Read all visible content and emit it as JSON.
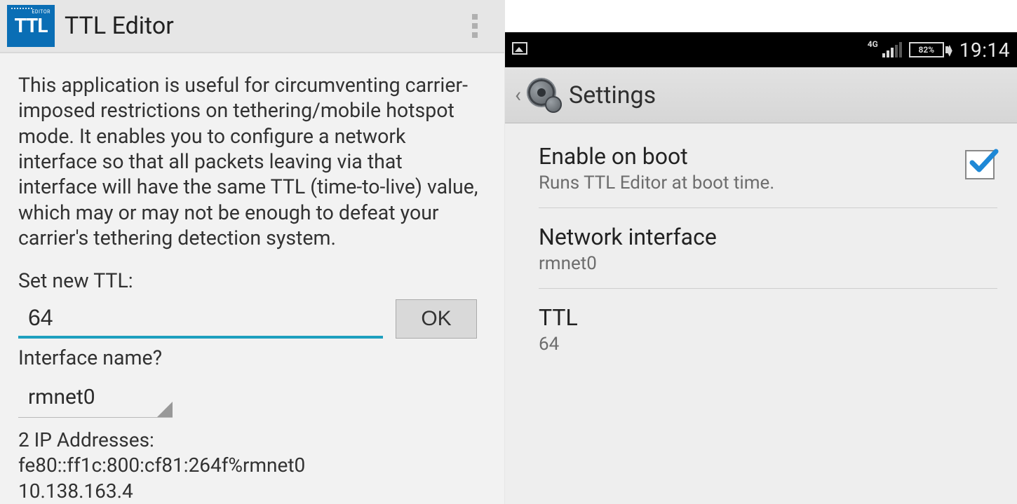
{
  "left": {
    "app_title": "TTL Editor",
    "description": "This application is useful for circumventing carrier-imposed restrictions on tethering/mobile hotspot mode. It enables you to configure a network interface so that all packets leaving via that interface will have the same TTL (time-to-live) value, which may or may not be enough to defeat your carrier's tethering detection system.",
    "set_ttl_label": "Set new TTL:",
    "ttl_value": "64",
    "ok_label": "OK",
    "iface_label": "Interface name?",
    "iface_selected": "rmnet0",
    "ip_header": "2 IP Addresses:",
    "ip_1": "fe80::ff1c:800:cf81:264f%rmnet0",
    "ip_2": "10.138.163.4"
  },
  "right": {
    "status": {
      "network_label": "4G",
      "battery_pct": "82%",
      "clock": "19:14"
    },
    "settings_title": "Settings",
    "prefs": {
      "boot_title": "Enable on boot",
      "boot_sub": "Runs TTL Editor at boot time.",
      "boot_checked": true,
      "iface_title": "Network interface",
      "iface_value": "rmnet0",
      "ttl_title": "TTL",
      "ttl_value": "64"
    }
  }
}
